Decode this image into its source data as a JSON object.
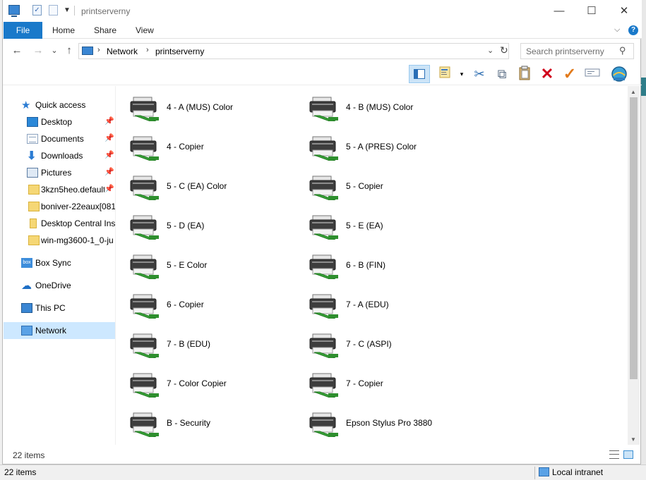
{
  "window": {
    "title": "printserverny",
    "minimize_glyph": "—",
    "maximize_glyph": "☐",
    "close_glyph": "✕"
  },
  "ribbon": {
    "tabs": [
      "File",
      "Home",
      "Share",
      "View"
    ],
    "expand_glyph": "⌵",
    "help_glyph": "?"
  },
  "address": {
    "back_glyph": "←",
    "forward_glyph": "→",
    "recent_glyph": "⌄",
    "up_glyph": "↑",
    "crumbs": [
      "Network",
      "printserverny"
    ],
    "chevron": "›",
    "dropdown_glyph": "⌄",
    "refresh_glyph": "↻"
  },
  "search": {
    "placeholder": "Search printserverny",
    "icon_glyph": "⚲"
  },
  "toolbar": {
    "icons": [
      "preview-pane-icon",
      "properties-icon",
      "cut-icon",
      "copy-icon",
      "paste-icon",
      "delete-icon",
      "check-icon",
      "rename-icon",
      "network-globe-icon"
    ],
    "cut_glyph": "✂",
    "copy_glyph": "⧉",
    "paste_glyph": "📋",
    "delete_glyph": "✕",
    "check_glyph": "✓",
    "props_dd_glyph": "▾",
    "colors": {
      "delete": "#d0021b",
      "check": "#e27a1b",
      "cut": "#2b6cb0",
      "globe": "#2d7fc1"
    }
  },
  "nav": {
    "pin_glyph": "📌",
    "star_glyph": "★",
    "down_glyph": "⬇",
    "cloud_glyph": "☁",
    "quick_access": "Quick access",
    "pinned": [
      {
        "label": "Desktop",
        "icon": "desktop-icon"
      },
      {
        "label": "Documents",
        "icon": "documents-icon"
      },
      {
        "label": "Downloads",
        "icon": "downloads-icon"
      },
      {
        "label": "Pictures",
        "icon": "pictures-icon"
      },
      {
        "label": "3kzn5heo.default",
        "icon": "folder-icon"
      },
      {
        "label": "boniver-22eaux[081",
        "icon": "folder-icon"
      },
      {
        "label": "Desktop Central Ins",
        "icon": "install-folder-icon"
      },
      {
        "label": "win-mg3600-1_0-ju",
        "icon": "folder-icon"
      }
    ],
    "box_label": "Box Sync",
    "box_icon_text": "box",
    "onedrive": "OneDrive",
    "thispc": "This PC",
    "network": "Network"
  },
  "printers": [
    "4 - A (MUS) Color",
    "4 - B (MUS) Color",
    "4 - Copier",
    "5 - A (PRES) Color",
    "5 - C (EA) Color",
    "5 - Copier",
    "5 - D (EA)",
    "5 - E (EA)",
    "5 - E Color",
    "6 - B (FIN)",
    "6 - Copier",
    "7 - A (EDU)",
    "7 - B (EDU)",
    "7 - C (ASPI)",
    "7 - Color Copier",
    "7 - Copier",
    "B - Security",
    "Epson Stylus Pro 3880"
  ],
  "scroll": {
    "up_glyph": "▲",
    "down_glyph": "▼"
  },
  "status": {
    "items": "22 items"
  },
  "outer_status": {
    "items": "22 items",
    "zone": "Local intranet"
  }
}
